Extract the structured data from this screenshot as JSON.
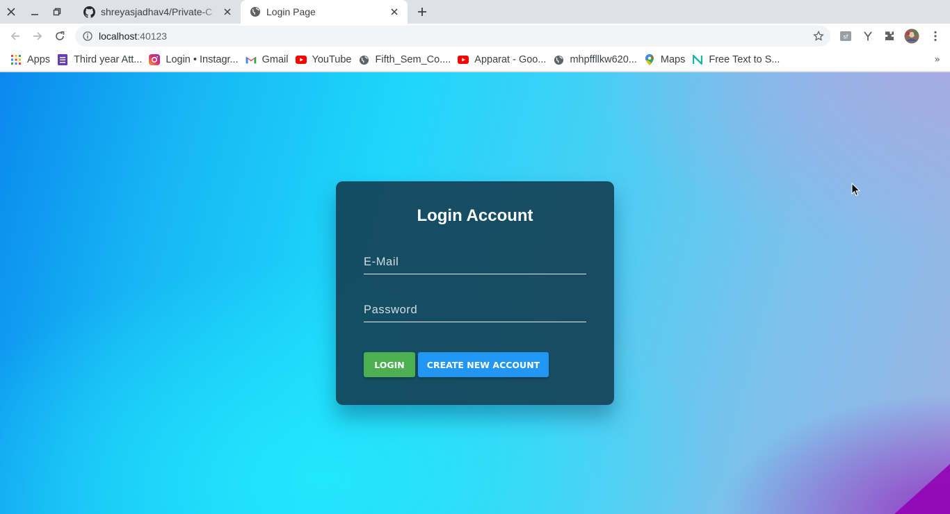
{
  "browser": {
    "tabs": [
      {
        "title": "shreyasjadhav4/Private-C",
        "favicon": "github-icon",
        "active": false
      },
      {
        "title": "Login Page",
        "favicon": "globe-icon",
        "active": true
      }
    ],
    "address_bar": {
      "host": "localhost",
      "port": ":40123"
    },
    "bookmarks": [
      {
        "label": "Apps",
        "icon": "apps-grid-icon"
      },
      {
        "label": "Third year Att...",
        "icon": "forms-icon"
      },
      {
        "label": "Login • Instagr...",
        "icon": "instagram-icon"
      },
      {
        "label": "Gmail",
        "icon": "gmail-icon"
      },
      {
        "label": "YouTube",
        "icon": "youtube-icon"
      },
      {
        "label": "Fifth_Sem_Co....",
        "icon": "globe-icon"
      },
      {
        "label": "Apparat - Goo...",
        "icon": "youtube-icon"
      },
      {
        "label": "mhpffllkw620...",
        "icon": "globe-icon"
      },
      {
        "label": "Maps",
        "icon": "maps-pin-icon"
      },
      {
        "label": "Free Text to S...",
        "icon": "naturalreader-icon"
      }
    ]
  },
  "login": {
    "title": "Login Account",
    "email_placeholder": "E-Mail",
    "password_placeholder": "Password",
    "login_button": "LOGIN",
    "create_button": "CREATE NEW ACCOUNT"
  },
  "colors": {
    "card": "#123a4e",
    "login_button": "#4caf50",
    "create_button": "#2196f3"
  }
}
